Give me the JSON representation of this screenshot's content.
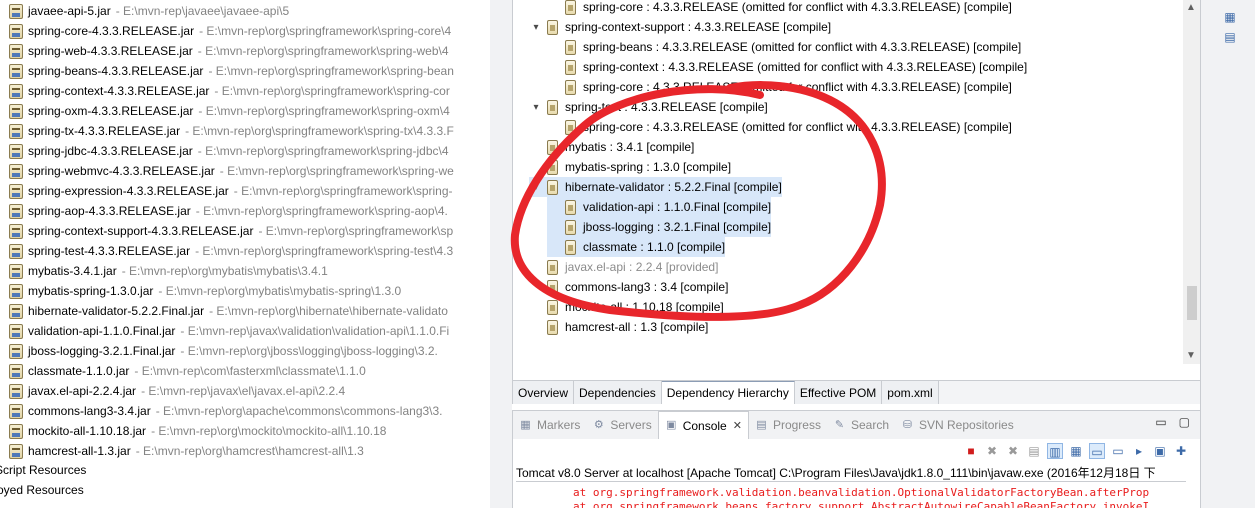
{
  "package_explorer": {
    "jars": [
      {
        "name": "javaee-api-5.jar",
        "path": "E:\\mvn-rep\\javaee\\javaee-api\\5"
      },
      {
        "name": "spring-core-4.3.3.RELEASE.jar",
        "path": "E:\\mvn-rep\\org\\springframework\\spring-core\\4"
      },
      {
        "name": "spring-web-4.3.3.RELEASE.jar",
        "path": "E:\\mvn-rep\\org\\springframework\\spring-web\\4"
      },
      {
        "name": "spring-beans-4.3.3.RELEASE.jar",
        "path": "E:\\mvn-rep\\org\\springframework\\spring-bean"
      },
      {
        "name": "spring-context-4.3.3.RELEASE.jar",
        "path": "E:\\mvn-rep\\org\\springframework\\spring-cor"
      },
      {
        "name": "spring-oxm-4.3.3.RELEASE.jar",
        "path": "E:\\mvn-rep\\org\\springframework\\spring-oxm\\4"
      },
      {
        "name": "spring-tx-4.3.3.RELEASE.jar",
        "path": "E:\\mvn-rep\\org\\springframework\\spring-tx\\4.3.3.F"
      },
      {
        "name": "spring-jdbc-4.3.3.RELEASE.jar",
        "path": "E:\\mvn-rep\\org\\springframework\\spring-jdbc\\4"
      },
      {
        "name": "spring-webmvc-4.3.3.RELEASE.jar",
        "path": "E:\\mvn-rep\\org\\springframework\\spring-we"
      },
      {
        "name": "spring-expression-4.3.3.RELEASE.jar",
        "path": "E:\\mvn-rep\\org\\springframework\\spring-"
      },
      {
        "name": "spring-aop-4.3.3.RELEASE.jar",
        "path": "E:\\mvn-rep\\org\\springframework\\spring-aop\\4."
      },
      {
        "name": "spring-context-support-4.3.3.RELEASE.jar",
        "path": "E:\\mvn-rep\\org\\springframework\\sp"
      },
      {
        "name": "spring-test-4.3.3.RELEASE.jar",
        "path": "E:\\mvn-rep\\org\\springframework\\spring-test\\4.3"
      },
      {
        "name": "mybatis-3.4.1.jar",
        "path": "E:\\mvn-rep\\org\\mybatis\\mybatis\\3.4.1"
      },
      {
        "name": "mybatis-spring-1.3.0.jar",
        "path": "E:\\mvn-rep\\org\\mybatis\\mybatis-spring\\1.3.0"
      },
      {
        "name": "hibernate-validator-5.2.2.Final.jar",
        "path": "E:\\mvn-rep\\org\\hibernate\\hibernate-validato"
      },
      {
        "name": "validation-api-1.1.0.Final.jar",
        "path": "E:\\mvn-rep\\javax\\validation\\validation-api\\1.1.0.Fi"
      },
      {
        "name": "jboss-logging-3.2.1.Final.jar",
        "path": "E:\\mvn-rep\\org\\jboss\\logging\\jboss-logging\\3.2."
      },
      {
        "name": "classmate-1.1.0.jar",
        "path": "E:\\mvn-rep\\com\\fasterxml\\classmate\\1.1.0"
      },
      {
        "name": "javax.el-api-2.2.4.jar",
        "path": "E:\\mvn-rep\\javax\\el\\javax.el-api\\2.2.4"
      },
      {
        "name": "commons-lang3-3.4.jar",
        "path": "E:\\mvn-rep\\org\\apache\\commons\\commons-lang3\\3."
      },
      {
        "name": "mockito-all-1.10.18.jar",
        "path": "E:\\mvn-rep\\org\\mockito\\mockito-all\\1.10.18"
      },
      {
        "name": "hamcrest-all-1.3.jar",
        "path": "E:\\mvn-rep\\org\\hamcrest\\hamcrest-all\\1.3"
      }
    ],
    "folders": [
      "Script Resources",
      "oyed Resources"
    ]
  },
  "dependency_tree": [
    {
      "indent": 2,
      "twisty": "",
      "label": "spring-core : 4.3.3.RELEASE (omitted for conflict with 4.3.3.RELEASE) [compile]",
      "selected": false,
      "dim": false
    },
    {
      "indent": 1,
      "twisty": "▾",
      "label": "spring-context-support : 4.3.3.RELEASE [compile]",
      "selected": false,
      "dim": false
    },
    {
      "indent": 2,
      "twisty": "",
      "label": "spring-beans : 4.3.3.RELEASE (omitted for conflict with 4.3.3.RELEASE) [compile]",
      "selected": false,
      "dim": false
    },
    {
      "indent": 2,
      "twisty": "",
      "label": "spring-context : 4.3.3.RELEASE (omitted for conflict with 4.3.3.RELEASE) [compile]",
      "selected": false,
      "dim": false
    },
    {
      "indent": 2,
      "twisty": "",
      "label": "spring-core : 4.3.3.RELEASE (omitted for conflict with 4.3.3.RELEASE) [compile]",
      "selected": false,
      "dim": false
    },
    {
      "indent": 1,
      "twisty": "▾",
      "label": "spring-test : 4.3.3.RELEASE [compile]",
      "selected": false,
      "dim": false
    },
    {
      "indent": 2,
      "twisty": "",
      "label": "spring-core : 4.3.3.RELEASE (omitted for conflict with 4.3.3.RELEASE) [compile]",
      "selected": false,
      "dim": false
    },
    {
      "indent": 1,
      "twisty": "",
      "label": "mybatis : 3.4.1 [compile]",
      "selected": false,
      "dim": false
    },
    {
      "indent": 1,
      "twisty": "",
      "label": "mybatis-spring : 1.3.0 [compile]",
      "selected": false,
      "dim": false
    },
    {
      "indent": 1,
      "twisty": "▾",
      "label": "hibernate-validator : 5.2.2.Final [compile]",
      "selected": true,
      "dim": false
    },
    {
      "indent": 2,
      "twisty": "",
      "label": "validation-api : 1.1.0.Final [compile]",
      "selected": true,
      "dim": false
    },
    {
      "indent": 2,
      "twisty": "",
      "label": "jboss-logging : 3.2.1.Final [compile]",
      "selected": true,
      "dim": false
    },
    {
      "indent": 2,
      "twisty": "",
      "label": "classmate : 1.1.0 [compile]",
      "selected": true,
      "dim": false
    },
    {
      "indent": 1,
      "twisty": "",
      "label": "javax.el-api : 2.2.4 [provided]",
      "selected": false,
      "dim": true
    },
    {
      "indent": 1,
      "twisty": "",
      "label": "commons-lang3 : 3.4 [compile]",
      "selected": false,
      "dim": false
    },
    {
      "indent": 1,
      "twisty": "",
      "label": "mockito-all : 1.10.18 [compile]",
      "selected": false,
      "dim": false
    },
    {
      "indent": 1,
      "twisty": "",
      "label": "hamcrest-all : 1.3 [compile]",
      "selected": false,
      "dim": false
    }
  ],
  "editor_tabs": [
    {
      "label": "Overview",
      "active": false
    },
    {
      "label": "Dependencies",
      "active": false
    },
    {
      "label": "Dependency Hierarchy",
      "active": true
    },
    {
      "label": "Effective POM",
      "active": false
    },
    {
      "label": "pom.xml",
      "active": false
    }
  ],
  "view_tabs": [
    {
      "label": "Markers",
      "icon": "markers-icon",
      "glyph": "▦",
      "active": false
    },
    {
      "label": "Servers",
      "icon": "servers-icon",
      "glyph": "⚙",
      "active": false
    },
    {
      "label": "Console",
      "icon": "console-icon",
      "glyph": "▣",
      "active": true,
      "close": "✕"
    },
    {
      "label": "Progress",
      "icon": "progress-icon",
      "glyph": "▤",
      "active": false
    },
    {
      "label": "Search",
      "icon": "search-icon",
      "glyph": "✎",
      "active": false
    },
    {
      "label": "SVN Repositories",
      "icon": "svn-repositories-icon",
      "glyph": "⛁",
      "active": false
    }
  ],
  "window_controls": {
    "minimize": "▭",
    "maximize": "▢"
  },
  "console": {
    "header": "Tomcat v8.0 Server at localhost [Apache Tomcat] C:\\Program Files\\Java\\jdk1.8.0_111\\bin\\javaw.exe (2016年12月18日 下",
    "lines": [
      "at org.springframework.validation.beanvalidation.OptionalValidatorFactoryBean.afterProp",
      "at org.springframework.beans.factory.support.AbstractAutowireCapableBeanFactory.invokeI"
    ],
    "toolbar": [
      {
        "icon": "terminate-icon",
        "glyph": "■",
        "kind": "red"
      },
      {
        "icon": "remove-launch-icon",
        "glyph": "✖",
        "kind": "gray"
      },
      {
        "icon": "remove-all-terminated-icon",
        "glyph": "✖",
        "kind": "gray"
      },
      {
        "icon": "clear-console-icon",
        "glyph": "▤",
        "kind": "gray"
      },
      {
        "icon": "scroll-lock-icon",
        "glyph": "▥",
        "kind": "on"
      },
      {
        "icon": "word-wrap-icon",
        "glyph": "▦",
        "kind": ""
      },
      {
        "icon": "show-on-stdout-icon",
        "glyph": "▭",
        "kind": "on"
      },
      {
        "icon": "show-on-stderr-icon",
        "glyph": "▭",
        "kind": ""
      },
      {
        "icon": "pin-console-icon",
        "glyph": "▸",
        "kind": ""
      },
      {
        "icon": "display-console-icon",
        "glyph": "▣",
        "kind": ""
      },
      {
        "icon": "open-console-icon",
        "glyph": "✚",
        "kind": ""
      }
    ]
  },
  "right_strip": [
    {
      "icon": "outline-icon",
      "glyph": "▦"
    },
    {
      "icon": "task-list-icon",
      "glyph": "▤"
    }
  ],
  "annotation_color": "#e8262b"
}
